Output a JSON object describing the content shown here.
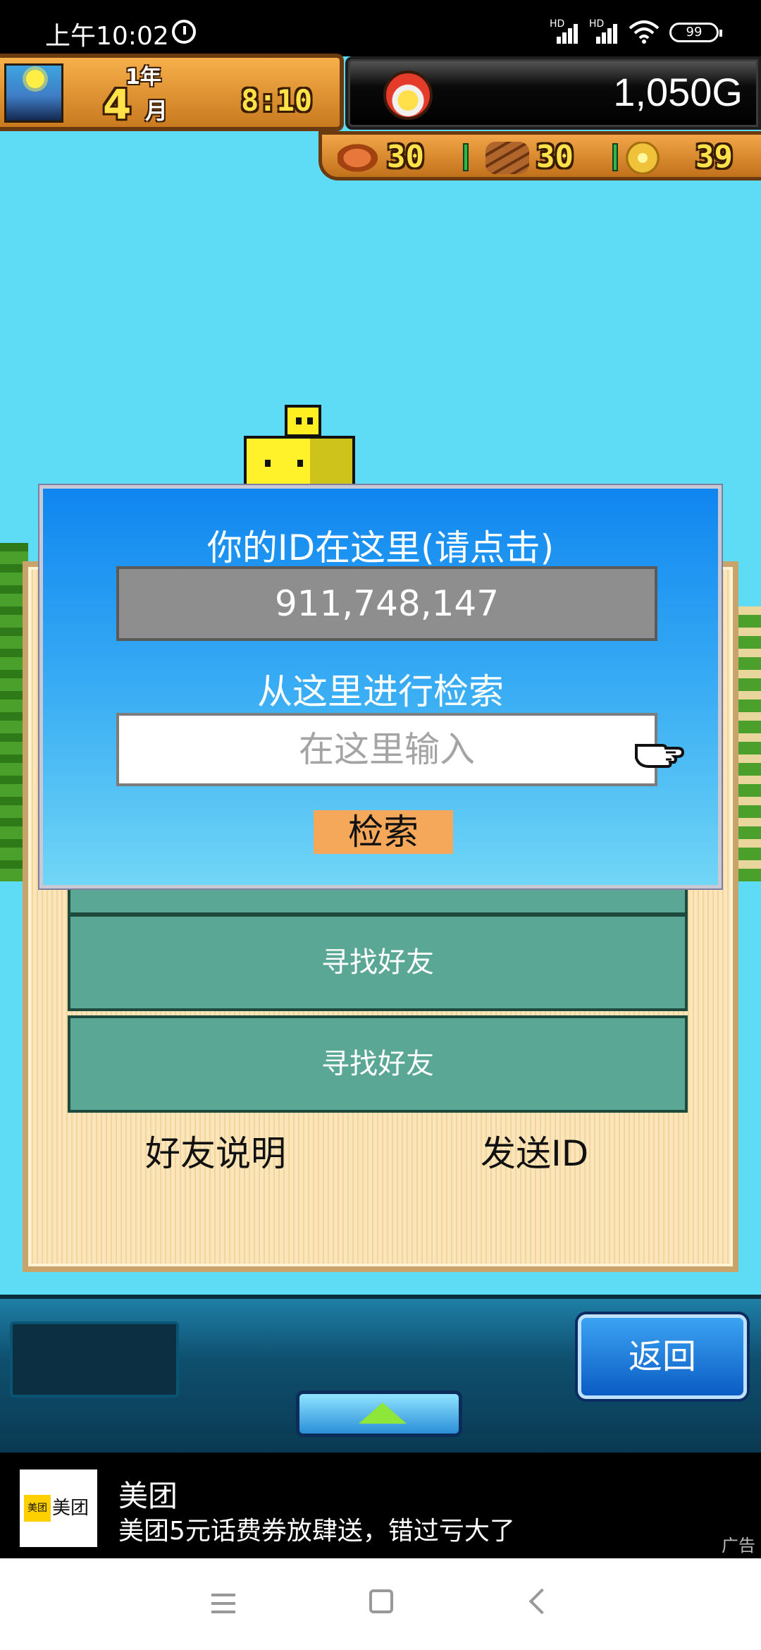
{
  "status_bar": {
    "time": "上午10:02",
    "hd_label": "HD",
    "battery": "99",
    "icons": [
      "alarm-icon",
      "signal-icon",
      "wifi-icon",
      "battery-icon"
    ]
  },
  "hud": {
    "year": "1年",
    "month_number": "4",
    "month_label": "月",
    "clock": "8:10",
    "gold": "1,050G",
    "resources": [
      {
        "icon": "food-icon",
        "value": "30"
      },
      {
        "icon": "wood-icon",
        "value": "30"
      },
      {
        "icon": "ore-icon",
        "value": "39"
      }
    ]
  },
  "dialog": {
    "title": "你的ID在这里(请点击)",
    "id_value": "911,748,147",
    "search_title": "从这里进行检索",
    "search_placeholder": "在这里输入",
    "search_button": "检索"
  },
  "board": {
    "rows": [
      "寻找好友",
      "寻找好友"
    ],
    "friend_help": "好友说明",
    "send_id": "发送ID"
  },
  "game_bar": {
    "back_button": "返回"
  },
  "ad": {
    "logo_text": "美团",
    "logo_mark": "美团",
    "title": "美团",
    "description": "美团5元话费券放肆送，错过亏大了",
    "tag": "广告"
  },
  "colors": {
    "sky": "#5fdcf5",
    "dialog_top": "#0f86f0",
    "dialog_bottom": "#71d6f6",
    "search_button": "#f6a85a",
    "friend_row": "#5aa795"
  }
}
